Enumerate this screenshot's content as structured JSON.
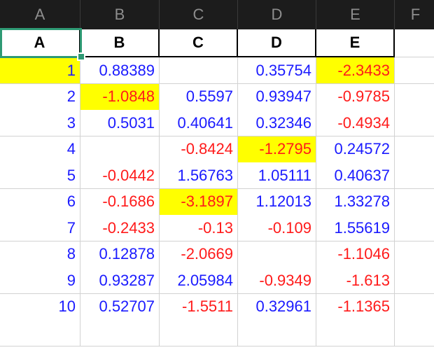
{
  "column_headers": [
    "A",
    "B",
    "C",
    "D",
    "E",
    "F"
  ],
  "header_row": [
    "A",
    "B",
    "C",
    "D",
    "E"
  ],
  "rows": [
    [
      "1",
      "0.88389",
      "",
      "0.35754",
      "-2.3433"
    ],
    [
      "2",
      "-1.0848",
      "0.5597",
      "0.93947",
      "-0.9785"
    ],
    [
      "3",
      "0.5031",
      "0.40641",
      "0.32346",
      "-0.4934"
    ],
    [
      "4",
      "",
      "-0.8424",
      "-1.2795",
      "0.24572"
    ],
    [
      "5",
      "-0.0442",
      "1.56763",
      "1.05111",
      "0.40637"
    ],
    [
      "6",
      "-0.1686",
      "-3.1897",
      "1.12013",
      "1.33278"
    ],
    [
      "7",
      "-0.2433",
      "-0.13",
      "-0.109",
      "1.55619"
    ],
    [
      "8",
      "0.12878",
      "-2.0669",
      "",
      "-1.1046"
    ],
    [
      "9",
      "0.93287",
      "2.05984",
      "-0.9349",
      "-1.613"
    ],
    [
      "10",
      "0.52707",
      "-1.5511",
      "0.32961",
      "-1.1365"
    ],
    [
      "",
      "",
      "",
      "",
      ""
    ]
  ],
  "highlighted_cells": [
    [
      0,
      0
    ],
    [
      0,
      4
    ],
    [
      1,
      1
    ],
    [
      3,
      3
    ],
    [
      5,
      2
    ]
  ],
  "selected_cell": "A1",
  "colors": {
    "positive_text": "#1a1aff",
    "negative_text": "#ff1a1a",
    "highlight": "#ffff00",
    "selection": "#2e9a74",
    "header_bar": "#1c1c1c"
  }
}
